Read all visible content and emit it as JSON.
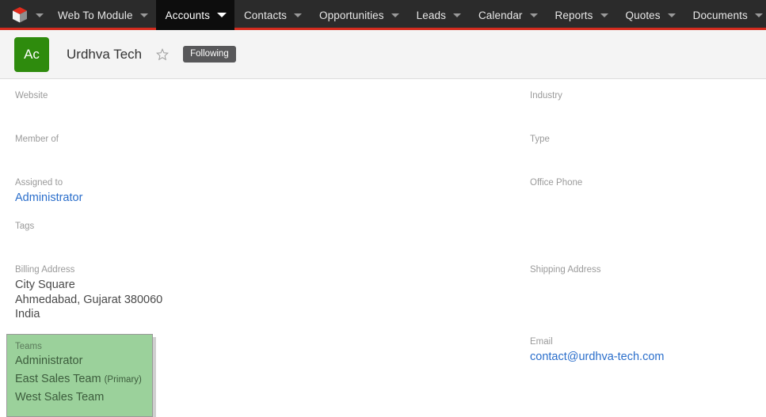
{
  "navbar": {
    "logo_icon": "cube-logo-icon",
    "logo_caret_icon": "caret-down-icon",
    "items": [
      {
        "label": "Web To Module",
        "active": false,
        "caret": "caret-down-icon"
      },
      {
        "label": "Accounts",
        "active": true,
        "caret": "caret-down-icon"
      },
      {
        "label": "Contacts",
        "active": false,
        "caret": "caret-down-icon"
      },
      {
        "label": "Opportunities",
        "active": false,
        "caret": "caret-down-icon"
      },
      {
        "label": "Leads",
        "active": false,
        "caret": "caret-down-icon"
      },
      {
        "label": "Calendar",
        "active": false,
        "caret": "caret-down-icon"
      },
      {
        "label": "Reports",
        "active": false,
        "caret": "caret-down-icon"
      },
      {
        "label": "Quotes",
        "active": false,
        "caret": "caret-down-icon"
      },
      {
        "label": "Documents",
        "active": false,
        "caret": "caret-down-icon"
      }
    ],
    "more_icon": "chevron-down-icon",
    "accent_color": "#d42b1e",
    "background_color": "#2b2b2b"
  },
  "record_header": {
    "avatar_text": "Ac",
    "avatar_color": "#2e8b0d",
    "title": "Urdhva Tech",
    "favorite_icon": "star-outline-icon",
    "follow_label": "Following"
  },
  "detail": {
    "left": [
      {
        "label": "Website",
        "value": ""
      },
      {
        "label": "Member of",
        "value": ""
      },
      {
        "label": "Assigned to",
        "value": "Administrator",
        "is_link": true
      },
      {
        "label": "Tags",
        "value": ""
      },
      {
        "label": "Billing Address",
        "value": "City Square\nAhmedabad,  Gujarat  380060\nIndia"
      }
    ],
    "right": [
      {
        "label": "Industry",
        "value": ""
      },
      {
        "label": "Type",
        "value": ""
      },
      {
        "label": "Office Phone",
        "value": ""
      },
      {
        "label": "Shipping Address",
        "value": ""
      },
      {
        "label": "Email",
        "value": "contact@urdhva-tech.com",
        "is_link": true
      }
    ]
  },
  "teams_panel": {
    "label": "Teams",
    "highlight_color": "#9bd19b",
    "rows": [
      {
        "name": "Administrator",
        "tag": ""
      },
      {
        "name": "East Sales Team",
        "tag": "(Primary)"
      },
      {
        "name": "West Sales Team",
        "tag": ""
      }
    ]
  }
}
